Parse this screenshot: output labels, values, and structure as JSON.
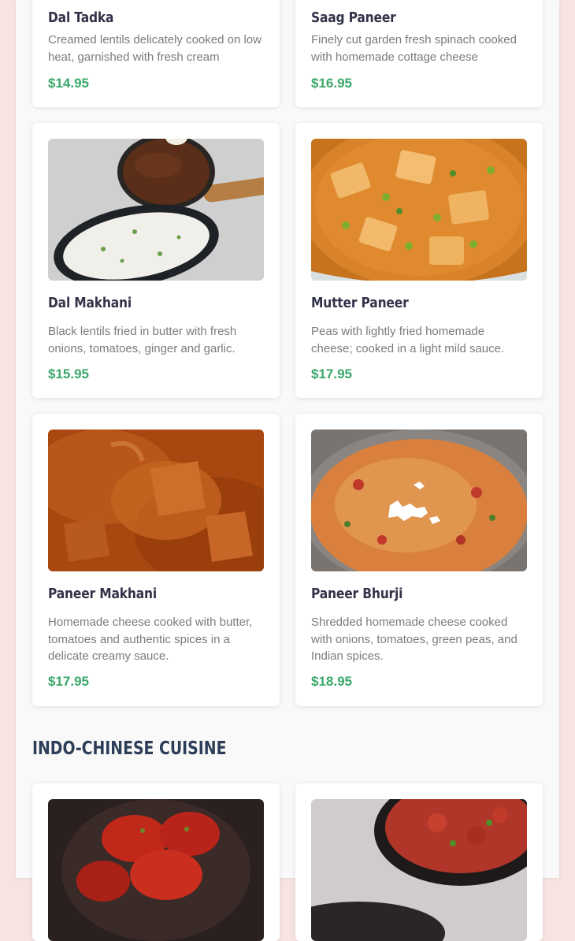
{
  "menu": {
    "items": [
      {
        "name": "Dal Tadka",
        "description": "Creamed lentils delicately cooked on low heat, garnished with fresh cream",
        "price": "$14.95"
      },
      {
        "name": "Saag Paneer",
        "description": "Finely cut garden fresh spinach cooked with homemade cottage cheese",
        "price": "$16.95"
      },
      {
        "name": "Dal Makhani",
        "description": "Black lentils fried in butter with fresh onions, tomatoes, ginger and garlic.",
        "price": "$15.95"
      },
      {
        "name": "Mutter Paneer",
        "description": "Peas with lightly fried homemade cheese; cooked in a light mild sauce.",
        "price": "$17.95"
      },
      {
        "name": "Paneer Makhani",
        "description": "Homemade cheese cooked with butter, tomatoes and authentic spices in a delicate creamy sauce.",
        "price": "$17.95"
      },
      {
        "name": "Paneer Bhurji",
        "description": "Shredded homemade cheese cooked with onions, tomatoes, green peas, and Indian spices.",
        "price": "$18.95"
      }
    ],
    "sections": [
      {
        "title": "INDO-CHINESE CUISINE"
      }
    ]
  },
  "colors": {
    "price": "#3aa86a",
    "heading": "#2c3e58",
    "background": "#f7e4e2"
  }
}
